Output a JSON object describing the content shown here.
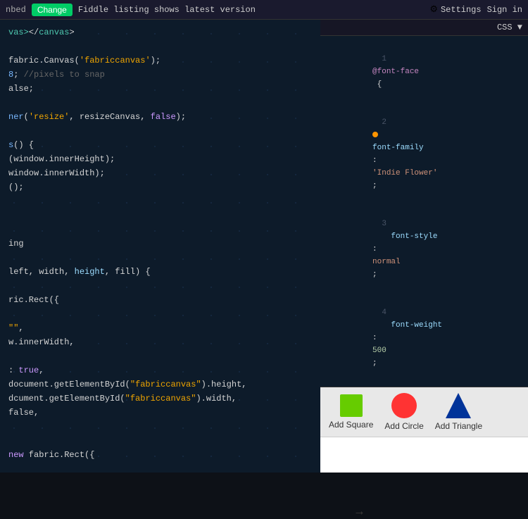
{
  "topbar": {
    "embed_label": "nbed",
    "change_btn": "Change",
    "notice": "Fiddle listing shows latest version",
    "settings_label": "Settings",
    "signin_label": "Sign in"
  },
  "css_panel": {
    "tab_label": "CSS ▼",
    "lines": [
      "@font-face {",
      "    font-family:'Indie Flower';",
      "    font-style: normal;",
      "    font-weight: 500;"
    ]
  },
  "preview": {
    "add_square": "Add Square",
    "add_circle": "Add Circle",
    "add_triangle": "Add Triangle"
  },
  "code": {
    "lines": [
      "vas\"></canvas>",
      "",
      "fabric.Canvas('fabriccanvas');",
      "8; //pixels to snap",
      "alse;",
      "",
      "ner('resize', resizeCanvas, false);",
      "",
      "s() {",
      "(window.innerHeight);",
      "window.innerWidth);",
      "();",
      "",
      "",
      "",
      "ing",
      "",
      "left, width, height, fill) {",
      "",
      "ric.Rect({",
      "",
      "\",",
      "w.innerWidth,",
      "",
      ": true,",
      "document.getElementById(\"fabriccanvas\").height,",
      "dcument.getElementById(\"fabriccanvas\").width,",
      "false,",
      "",
      "",
      "new fabric.Rect({"
    ]
  }
}
